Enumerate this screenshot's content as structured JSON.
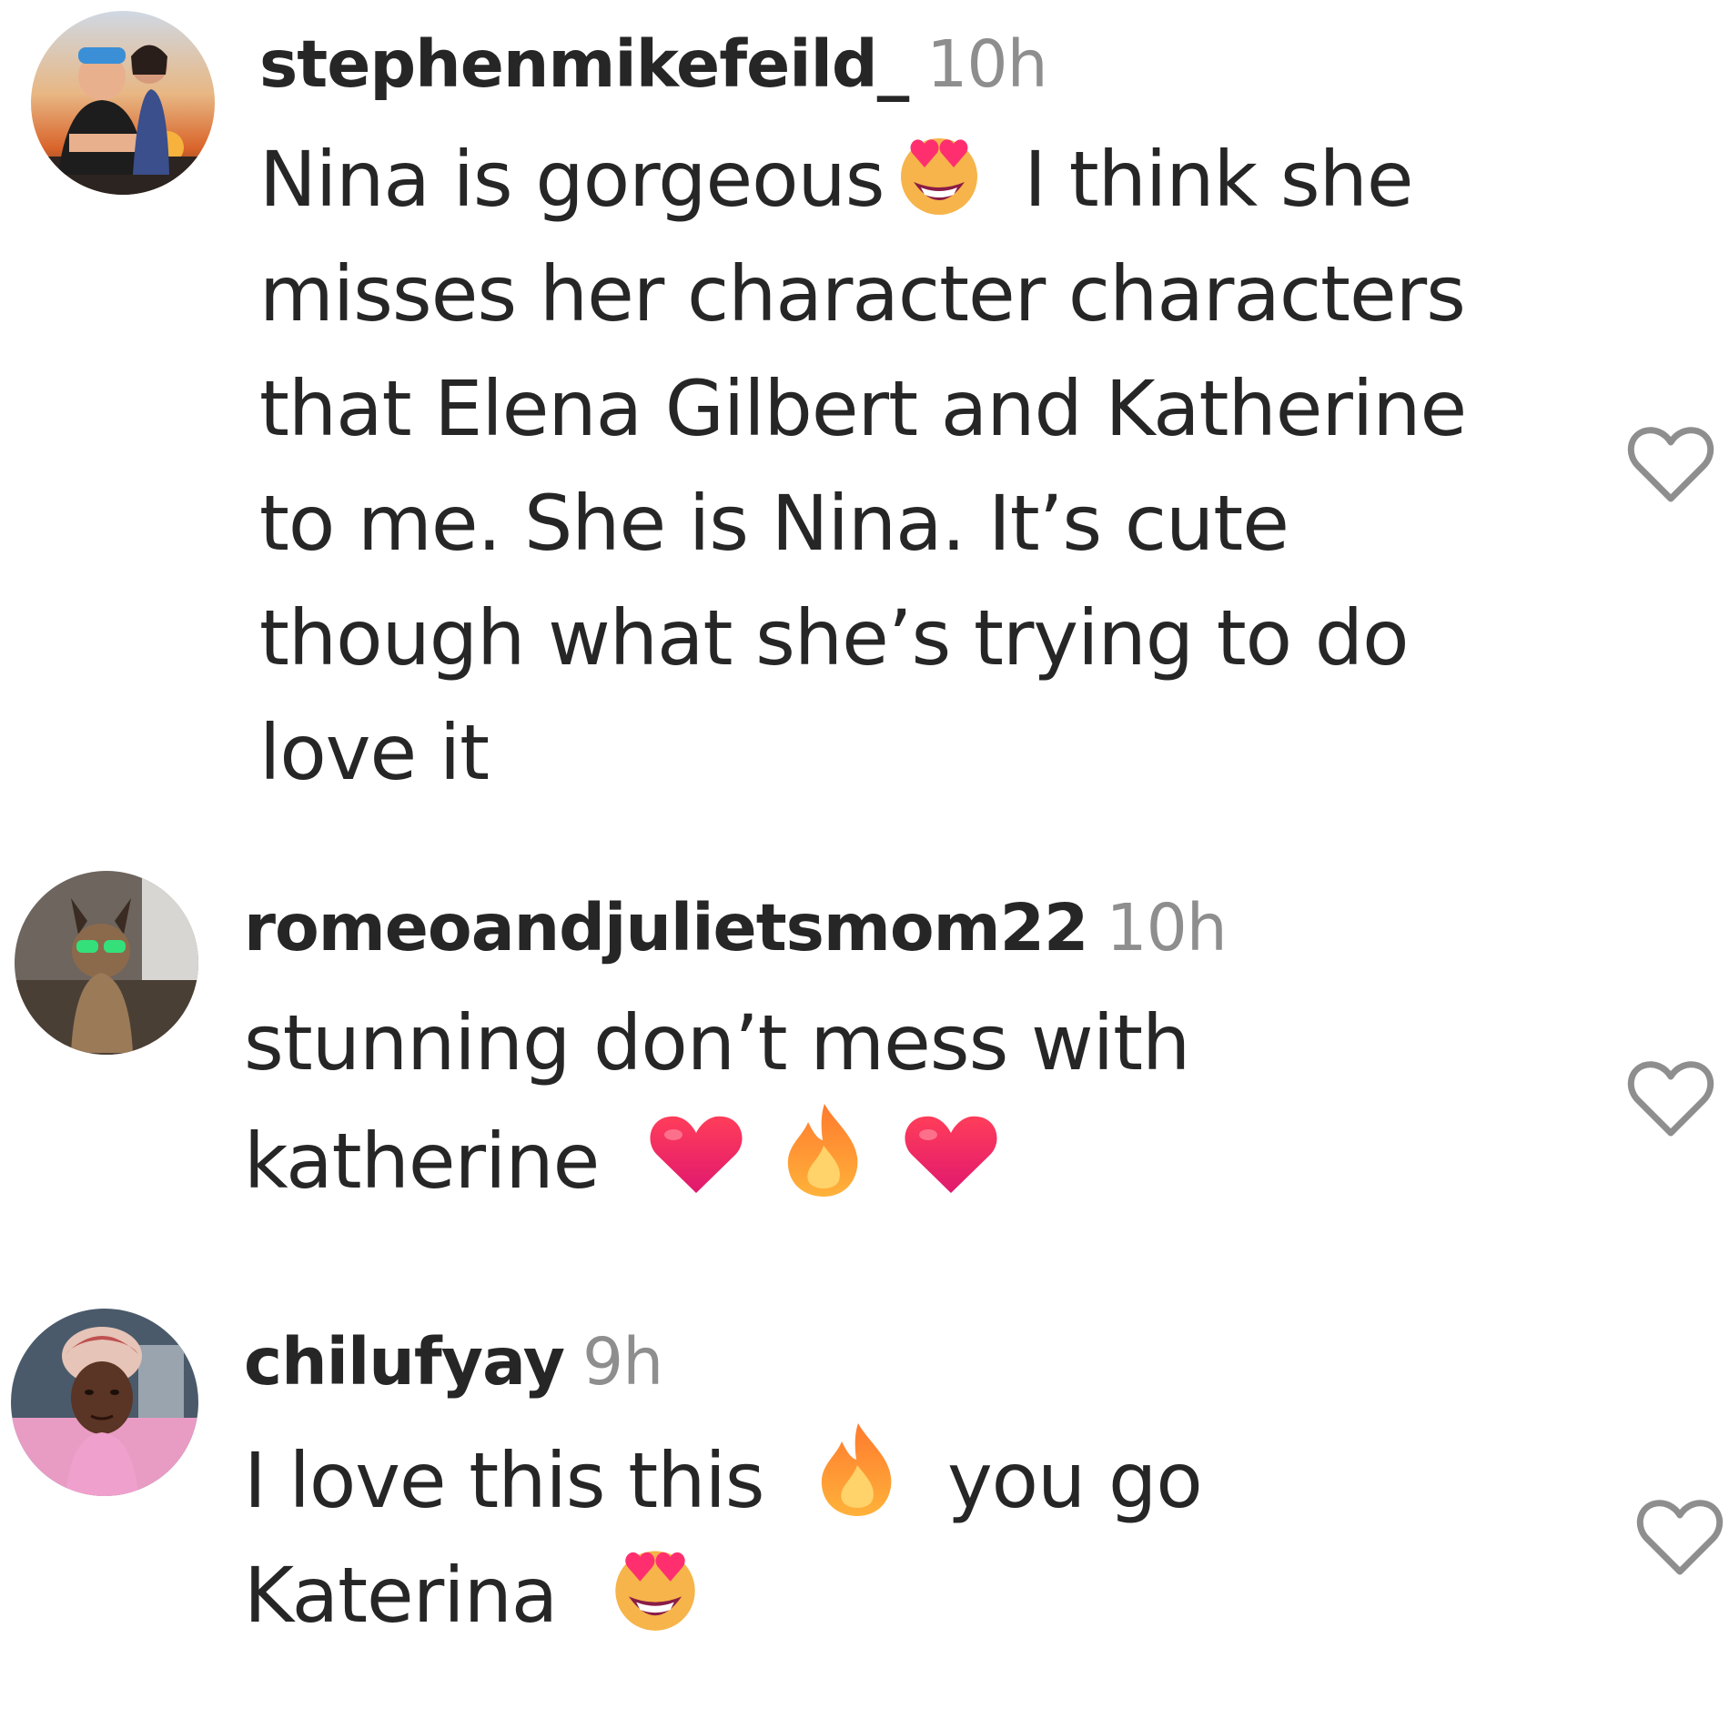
{
  "comments": [
    {
      "username": "stephenmikefeild_",
      "time": "10h",
      "lines": [
        [
          "Nina is gorgeous",
          "heart-eyes-emoji",
          " I think she"
        ],
        [
          "misses her character characters"
        ],
        [
          "that Elena Gilbert and Katherine"
        ],
        [
          "to me. She is Nina. It’s cute"
        ],
        [
          "though what she’s trying to do"
        ],
        [
          "love it"
        ]
      ],
      "like_icon": "heart-outline-icon"
    },
    {
      "username": "romeoandjulietsmom22",
      "time": "10h",
      "lines": [
        [
          "stunning don’t mess with"
        ],
        [
          "katherine ",
          "red-heart-emoji",
          "fire-emoji",
          "red-heart-emoji"
        ]
      ],
      "like_icon": "heart-outline-icon"
    },
    {
      "username": "chilufyay",
      "time": "9h",
      "lines": [
        [
          "I love this this ",
          "fire-emoji",
          " you go"
        ],
        [
          "Katerina ",
          "heart-eyes-emoji"
        ]
      ],
      "like_icon": "heart-outline-icon"
    }
  ],
  "colors": {
    "text": "#262626",
    "muted": "#8e8e8e",
    "background": "#ffffff"
  }
}
